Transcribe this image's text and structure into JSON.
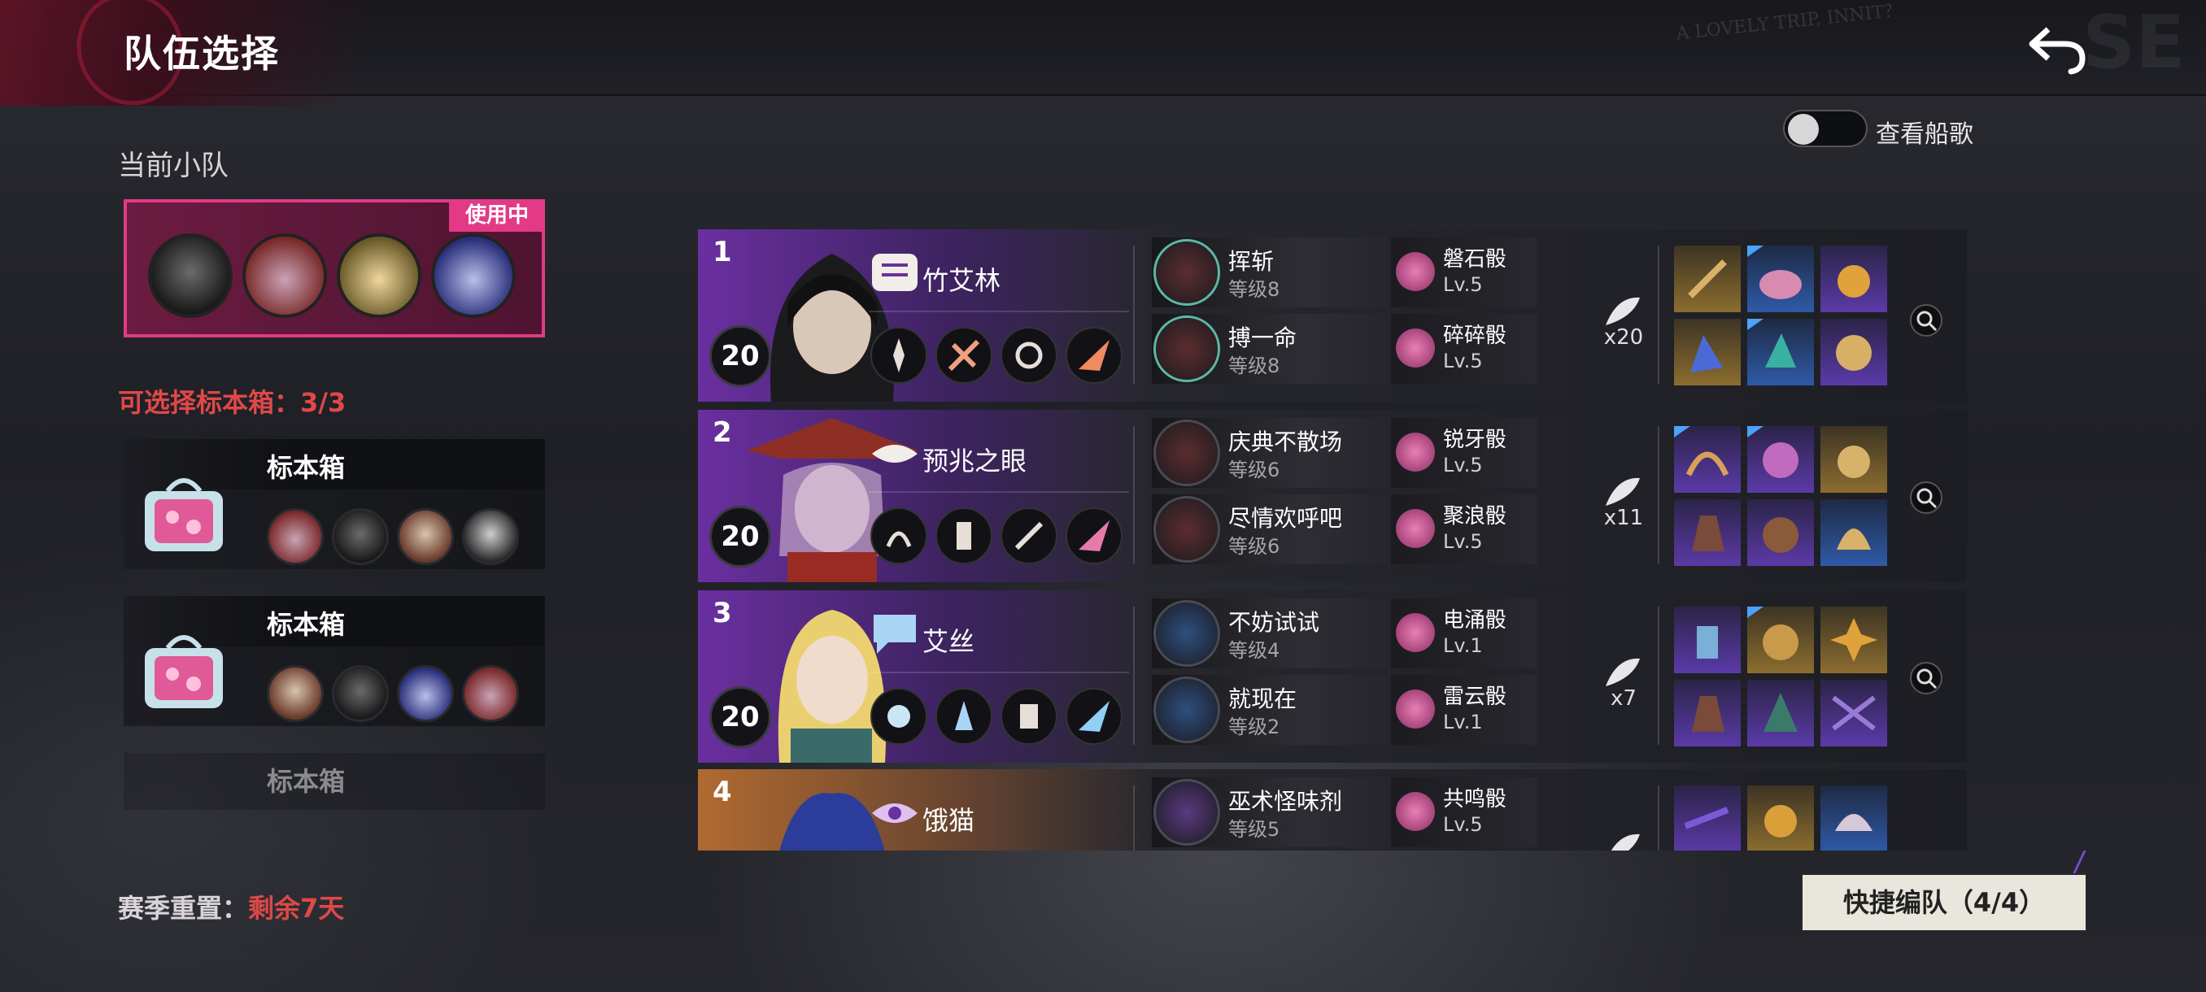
{
  "header": {
    "title": "队伍选择",
    "handwritten_note": "A LOVELY TRIP, INNIT？",
    "watermark": "SE"
  },
  "toggle": {
    "label": "查看船歌",
    "on": false
  },
  "left": {
    "current_team_label": "当前小队",
    "in_use_badge": "使用中",
    "selectable_boxes": "可选择标本箱：3/3",
    "boxes": [
      {
        "name": "标本箱"
      },
      {
        "name": "标本箱"
      },
      {
        "name": "标本箱"
      }
    ],
    "season_label": "赛季重置：",
    "season_remaining": "剩余7天"
  },
  "teams": [
    {
      "index": "1",
      "level": "20",
      "name": "竹艾林",
      "skills": [
        {
          "name": "挥斩",
          "level": "等级8"
        },
        {
          "name": "搏一命",
          "level": "等级8"
        }
      ],
      "dice": [
        {
          "name": "磐石骰",
          "level": "Lv.5"
        },
        {
          "name": "碎碎骰",
          "level": "Lv.5"
        }
      ],
      "count": "x20"
    },
    {
      "index": "2",
      "level": "20",
      "name": "预兆之眼",
      "skills": [
        {
          "name": "庆典不散场",
          "level": "等级6"
        },
        {
          "name": "尽情欢呼吧",
          "level": "等级6"
        }
      ],
      "dice": [
        {
          "name": "锐牙骰",
          "level": "Lv.5"
        },
        {
          "name": "聚浪骰",
          "level": "Lv.5"
        }
      ],
      "count": "x11"
    },
    {
      "index": "3",
      "level": "20",
      "name": "艾丝",
      "skills": [
        {
          "name": "不妨试试",
          "level": "等级4"
        },
        {
          "name": "就现在",
          "level": "等级2"
        }
      ],
      "dice": [
        {
          "name": "电涌骰",
          "level": "Lv.1"
        },
        {
          "name": "雷云骰",
          "level": "Lv.1"
        }
      ],
      "count": "x7"
    },
    {
      "index": "4",
      "name": "饿猫",
      "skills": [
        {
          "name": "巫术怪味剂",
          "level": "等级5"
        }
      ],
      "dice": [
        {
          "name": "共鸣骰",
          "level": "Lv.5"
        }
      ]
    }
  ],
  "quick_button": "快捷编队（4/4）",
  "colors": {
    "accent_pink": "#e23a86",
    "warning_red": "#e04848",
    "purple_row": "#6a2fa0"
  }
}
